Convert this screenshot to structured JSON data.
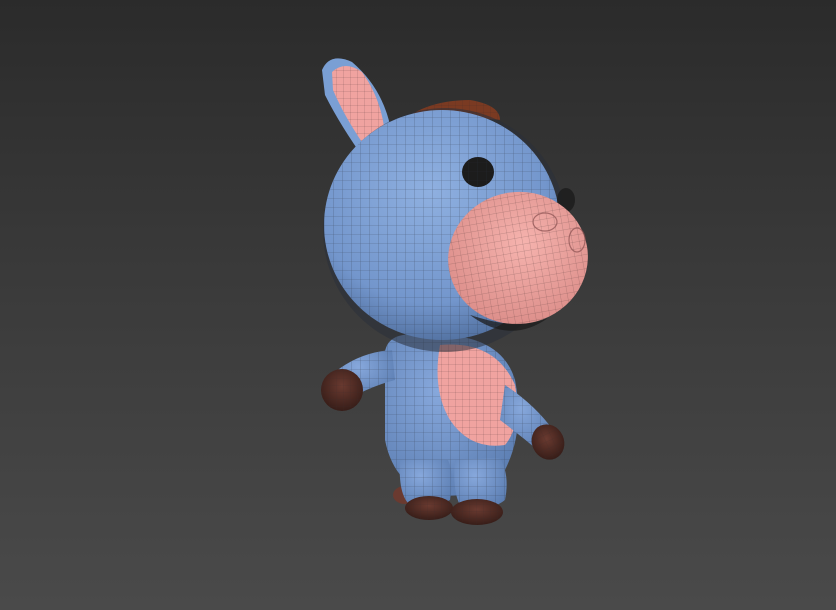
{
  "viewport": {
    "background_top": "#2b2b2b",
    "background_bottom": "#4a4a4a"
  },
  "model": {
    "subject": "cartoon-donkey-character",
    "display_mode": "shaded-with-wireframe",
    "colors": {
      "body": "#7a9fd4",
      "body_shadow": "#4f6f9e",
      "muzzle": "#f0a3a0",
      "inner_ear": "#f0a3a0",
      "hooves": "#4a2a22",
      "hair_tuft": "#7a3a22",
      "eyes": "#1c1c1c",
      "wire": "#2e3340"
    }
  }
}
